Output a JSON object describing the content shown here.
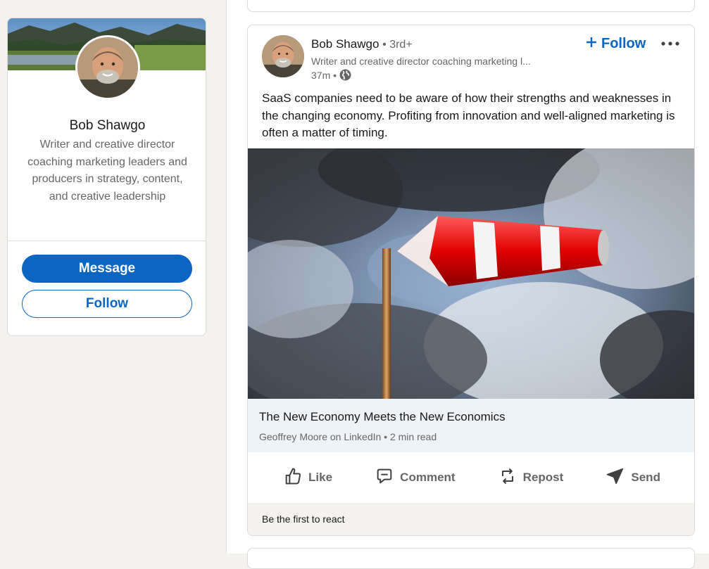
{
  "profile": {
    "name": "Bob Shawgo",
    "headline": "Writer and creative director coaching marketing leaders and producers in strategy, content, and creative leadership",
    "message_label": "Message",
    "follow_label": "Follow"
  },
  "post": {
    "author_name": "Bob Shawgo",
    "author_degree": "• 3rd+",
    "author_headline": "Writer and creative director coaching marketing l...",
    "time": "37m •",
    "follow_label": "Follow",
    "text": "SaaS companies need to be aware of how their strengths and weaknesses in the changing economy. Profiting from innovation and well-aligned marketing is often a matter of timing.",
    "article_title": "The New Economy Meets the New Economics",
    "article_source": "Geoffrey Moore on LinkedIn • 2 min read",
    "actions": {
      "like": "Like",
      "comment": "Comment",
      "repost": "Repost",
      "send": "Send"
    },
    "reactions_text": "Be the first to react"
  },
  "colors": {
    "accent": "#0a66c2",
    "muted_text": "#666666",
    "page_bg": "#f4f2ee",
    "article_bg": "#eef3f8"
  },
  "icons": {
    "follow": "plus-icon",
    "more": "more-horizontal-icon",
    "visibility": "globe-icon",
    "like": "thumbs-up-icon",
    "comment": "comment-icon",
    "repost": "repost-icon",
    "send": "send-icon"
  }
}
